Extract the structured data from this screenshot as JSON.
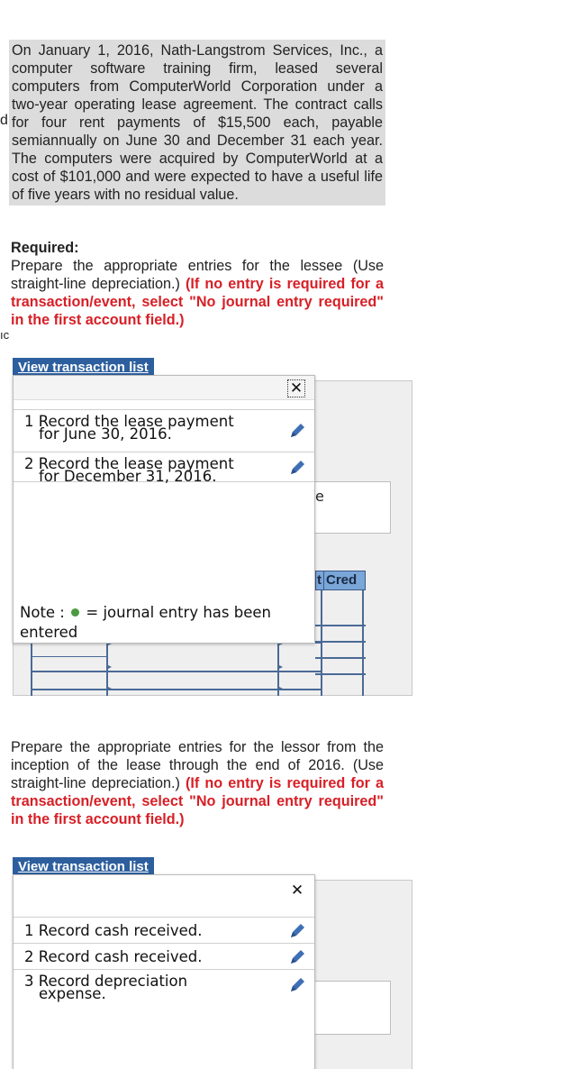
{
  "problem": {
    "text": "On January 1, 2016, Nath-Langstrom Services, Inc., a computer software training firm, leased several computers from ComputerWorld Corporation under a two-year operating lease agreement. The contract calls for four rent payments of $15,500 each, payable semiannually on June 30 and December 31 each year. The computers were acquired by ComputerWorld at a cost of $101,000 and were expected to have a useful life of five years with no residual value.",
    "cut_char_1": "d",
    "cut_char_2": "ıc"
  },
  "lessee": {
    "required_heading": "Required:",
    "instruction": "Prepare the appropriate entries for the lessee (Use straight-line depreciation.)",
    "instruction_red": "(If no entry is required for a transaction/event, select \"No journal entry required\" in the first account field.)",
    "view_button": "View transaction list",
    "close": "✕",
    "transactions": [
      {
        "num": "1",
        "line1": "Record the lease payment",
        "line2": "for June 30, 2016."
      },
      {
        "num": "2",
        "line1": "Record the lease payment",
        "line2": "for December 31, 2016."
      }
    ],
    "note_prefix": "Note :",
    "note_suffix": "= journal entry has been entered",
    "partial_e": "e",
    "col_header_left": "t",
    "col_header_right": "Cred"
  },
  "lessor": {
    "instruction": "Prepare the appropriate entries for the lessor from the inception of the lease through the end of 2016. (Use straight-line depreciation.)",
    "instruction_red": "(If no entry is required for a transaction/event, select \"No journal entry required\" in the first account field.)",
    "view_button": "View transaction list",
    "close": "✕",
    "transactions": [
      {
        "num": "1",
        "line1": "Record cash received.",
        "line2": ""
      },
      {
        "num": "2",
        "line1": "Record cash received.",
        "line2": ""
      },
      {
        "num": "3",
        "line1": "Record depreciation",
        "line2": "expense."
      }
    ]
  },
  "colors": {
    "accent_blue": "#2d5f9e",
    "red_text": "#d71f26",
    "entered_dot": "#4a9a3e",
    "pencil": "#3f6fb5"
  }
}
